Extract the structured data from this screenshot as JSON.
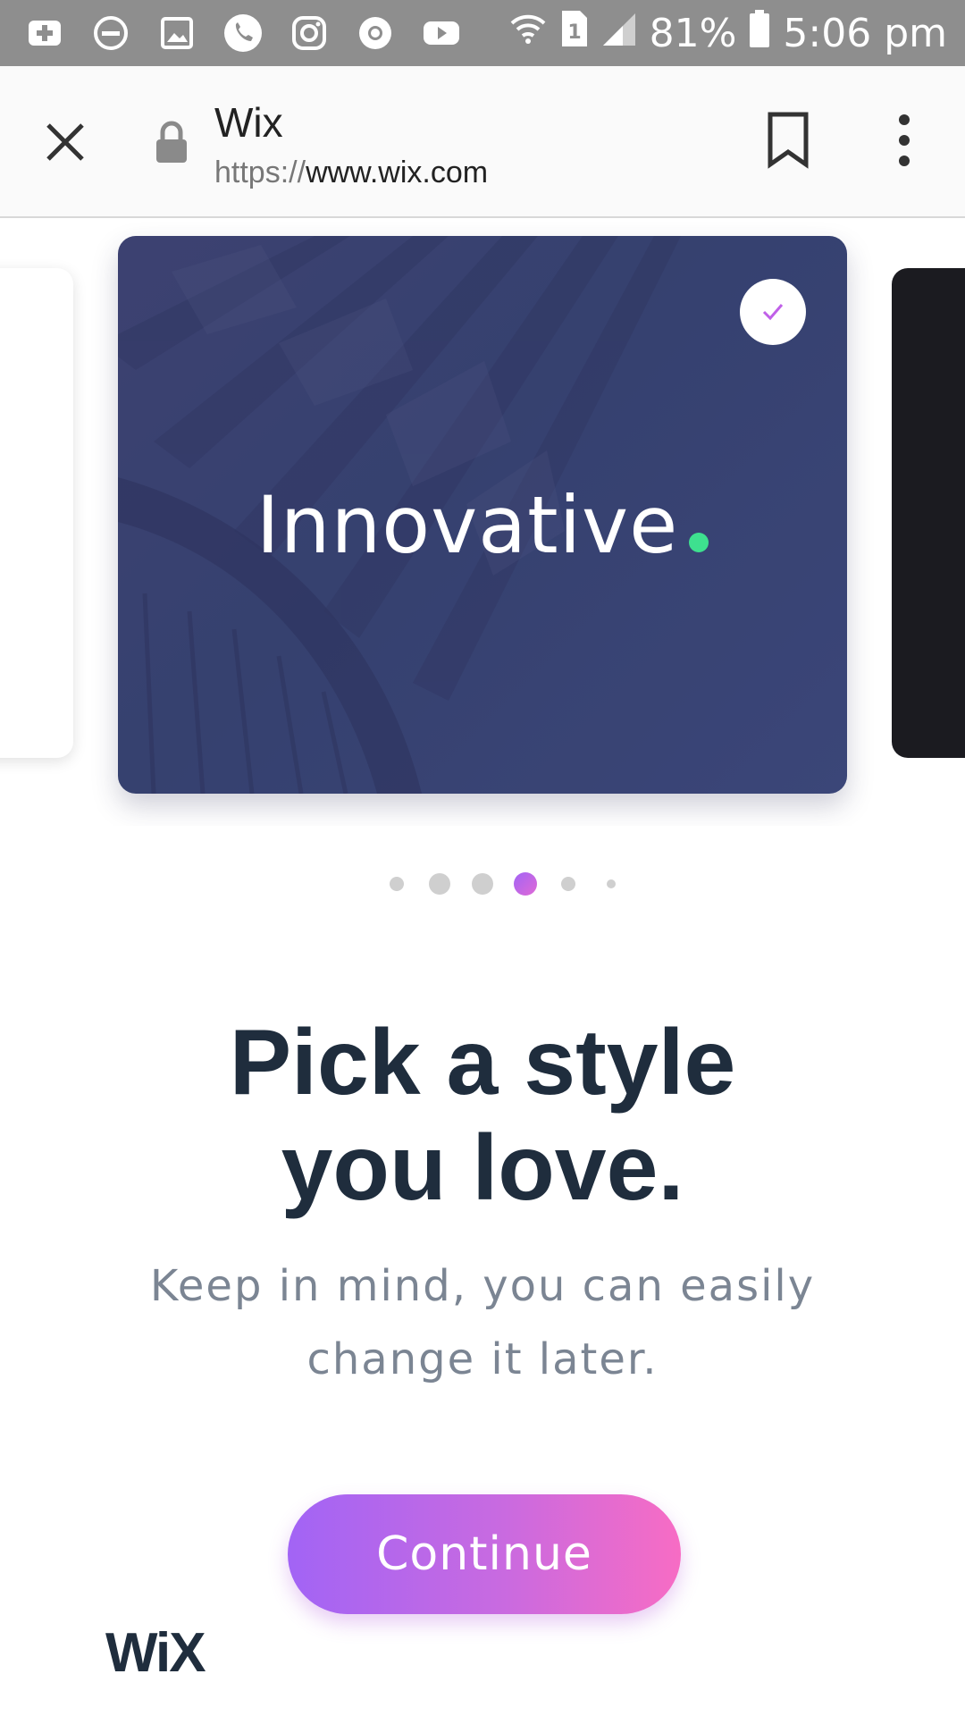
{
  "status_bar": {
    "battery_percent": "81%",
    "time": "5:06 pm",
    "icons_left": [
      "add-box-icon",
      "do-not-disturb-icon",
      "gallery-icon",
      "phone-icon",
      "instagram-icon",
      "chrome-icon",
      "youtube-icon"
    ],
    "icons_right": [
      "wifi-icon",
      "sim-1-icon",
      "signal-icon",
      "battery-icon"
    ]
  },
  "browser": {
    "close_icon": "close-icon",
    "lock_icon": "lock-icon",
    "page_title": "Wix",
    "url_scheme": "https://",
    "url_host": "www.wix.com",
    "bookmark_icon": "bookmark-icon",
    "menu_icon": "more-vert-icon"
  },
  "carousel": {
    "active_card": {
      "title": "Innovative",
      "accent_dot_color": "#3ee08f",
      "selected": true
    },
    "page_count": 6,
    "active_index": 3,
    "active_dot_color": "#b064ec"
  },
  "onboarding": {
    "headline_line1": "Pick a style",
    "headline_line2": "you love.",
    "sub_line1": "Keep in mind, you can easily",
    "sub_line2": "change it later.",
    "continue_label": "Continue"
  },
  "footer": {
    "logo_text": "WiX"
  },
  "colors": {
    "status_bar": "#8e8e8e",
    "headline": "#1f2d3d",
    "subtext": "#7b8593",
    "button_start": "#a264f5",
    "button_end": "#f76cc4"
  }
}
